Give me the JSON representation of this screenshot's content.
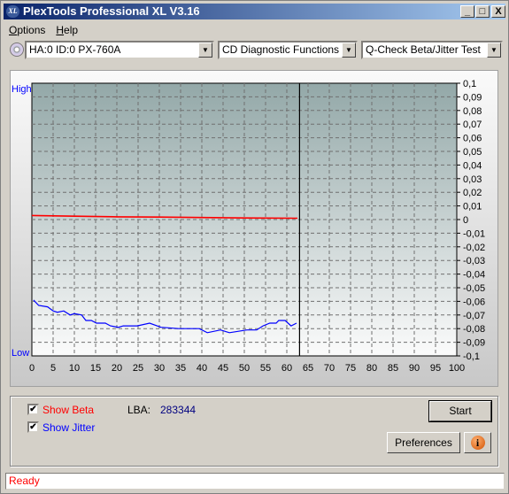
{
  "window": {
    "title": "PlexTools Professional XL V3.16",
    "logo": "XL",
    "minimize": "_",
    "maximize": "□",
    "close": "X"
  },
  "menu": [
    {
      "label": "Options",
      "accel": "O",
      "rest": "ptions"
    },
    {
      "label": "Help",
      "accel": "H",
      "rest": "elp"
    }
  ],
  "toolbar": {
    "drive": "HA:0 ID:0  PX-760A",
    "category": "CD Diagnostic Functions",
    "test": "Q-Check Beta/Jitter Test"
  },
  "colors": {
    "beta": "#ff0000",
    "jitter": "#0000ff",
    "accent": "#0a246a"
  },
  "chart_data": {
    "type": "line",
    "left_labels": {
      "high": "High",
      "low": "Low"
    },
    "xlim": [
      0,
      100
    ],
    "ylim": [
      -0.1,
      0.1
    ],
    "x_ticks": [
      "0",
      "5",
      "10",
      "15",
      "20",
      "25",
      "30",
      "35",
      "40",
      "45",
      "50",
      "55",
      "60",
      "65",
      "70",
      "75",
      "80",
      "85",
      "90",
      "95",
      "100"
    ],
    "y_ticks": [
      "0,1",
      "0,09",
      "0,08",
      "0,07",
      "0,06",
      "0,05",
      "0,04",
      "0,03",
      "0,02",
      "0,01",
      "0",
      "-0,01",
      "-0,02",
      "-0,03",
      "-0,04",
      "-0,05",
      "-0,06",
      "-0,07",
      "-0,08",
      "-0,09",
      "-0,1"
    ],
    "grid": true,
    "progress_marker": 63,
    "series": [
      {
        "key": "beta",
        "color": "#ff0000",
        "x": [
          0,
          10,
          20,
          30,
          40,
          50,
          62.5
        ],
        "y": [
          0.003,
          0.0025,
          0.002,
          0.0018,
          0.0015,
          0.0012,
          0.001
        ]
      },
      {
        "key": "jitter",
        "color": "#0000ff",
        "x": [
          0.4,
          1.6,
          3.7,
          5,
          6,
          7.5,
          9,
          10,
          11.7,
          12.7,
          14,
          15.2,
          17.3,
          18.5,
          20.4,
          21.5,
          24.8,
          27.7,
          30.4,
          34.6,
          39.4,
          41.3,
          44.4,
          46.5,
          50.6,
          52.9,
          54.4,
          56,
          57.5,
          58.1,
          59.6,
          61,
          62.3
        ],
        "y": [
          -0.059,
          -0.063,
          -0.064,
          -0.067,
          -0.068,
          -0.067,
          -0.07,
          -0.069,
          -0.07,
          -0.074,
          -0.074,
          -0.076,
          -0.076,
          -0.078,
          -0.079,
          -0.078,
          -0.078,
          -0.076,
          -0.079,
          -0.08,
          -0.08,
          -0.083,
          -0.081,
          -0.083,
          -0.081,
          -0.081,
          -0.078,
          -0.076,
          -0.076,
          -0.074,
          -0.074,
          -0.078,
          -0.076
        ]
      }
    ]
  },
  "controls": {
    "show_beta": "Show Beta",
    "show_beta_checked": true,
    "show_jitter": "Show Jitter",
    "show_jitter_checked": true,
    "lba_label": "LBA:",
    "lba_value": "283344",
    "start": "Start",
    "preferences": "Preferences",
    "info_icon": "info-icon"
  },
  "status": "Ready"
}
